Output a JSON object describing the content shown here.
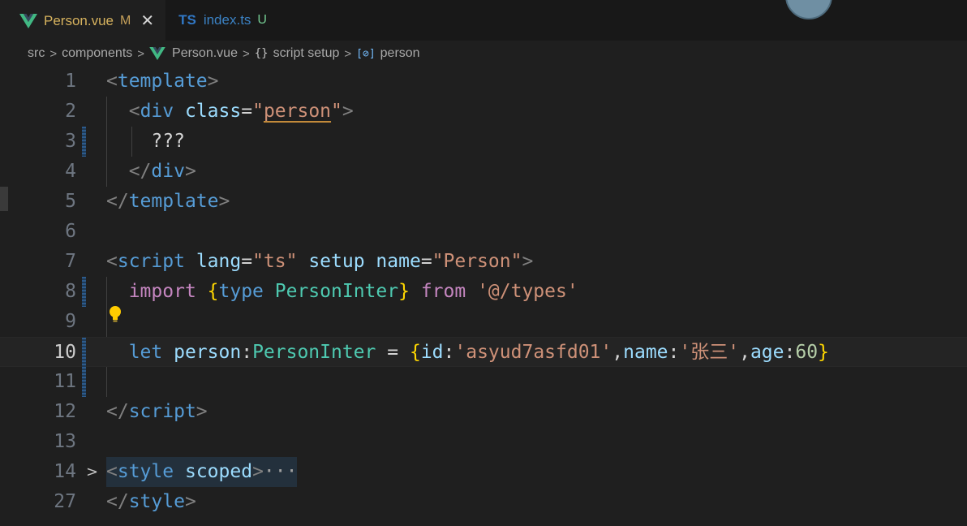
{
  "tabs": [
    {
      "label": "Person.vue",
      "status": "M",
      "active": true
    },
    {
      "label": "index.ts",
      "status": "U",
      "icon": "TS",
      "active": false
    }
  ],
  "breadcrumb": {
    "src": "src",
    "components": "components",
    "file": "Person.vue",
    "braces": "{}",
    "script_setup": "script setup",
    "symbol_icon": "[⊘]",
    "symbol": "person"
  },
  "lines": {
    "n1": "1",
    "n2": "2",
    "n3": "3",
    "n4": "4",
    "n5": "5",
    "n6": "6",
    "n7": "7",
    "n8": "8",
    "n9": "9",
    "n10": "10",
    "n11": "11",
    "n12": "12",
    "n13": "13",
    "n14": "14",
    "n27": "27"
  },
  "code": {
    "l1_tag": "template",
    "l2_tag": "div",
    "l2_attr": "class",
    "l2_val": "person",
    "l3_text": "???",
    "l4_tag": "div",
    "l5_tag": "template",
    "l7_tag": "script",
    "l7_attr1": "lang",
    "l7_val1": "\"ts\"",
    "l7_attr2": "setup",
    "l7_attr3": "name",
    "l7_val3": "\"Person\"",
    "l8_import": "import",
    "l8_type": "type",
    "l8_name": "PersonInter",
    "l8_from": "from",
    "l8_path": "'@/types'",
    "l10_let": "let",
    "l10_var": "person",
    "l10_type": "PersonInter",
    "l10_k1": "id",
    "l10_v1": "'asyud7asfd01'",
    "l10_k2": "name",
    "l10_v2": "'张三'",
    "l10_k3": "age",
    "l10_v3": "60",
    "l12_tag": "script",
    "l14_tag": "style",
    "l14_attr": "scoped",
    "l14_ellipsis": "···",
    "l27_tag": "style"
  },
  "colors": {
    "background": "#1f1f1f",
    "tag": "#569cd6",
    "attribute": "#9cdcfe",
    "string": "#ce9178",
    "keyword": "#c586c0",
    "type": "#4ec9b0",
    "number": "#b5cea8",
    "bracket": "#ffd700"
  },
  "icons": [
    "vue-icon",
    "typescript-icon",
    "close-icon",
    "chevron-right-icon",
    "braces-icon",
    "symbol-variable-icon",
    "lightbulb-icon"
  ]
}
